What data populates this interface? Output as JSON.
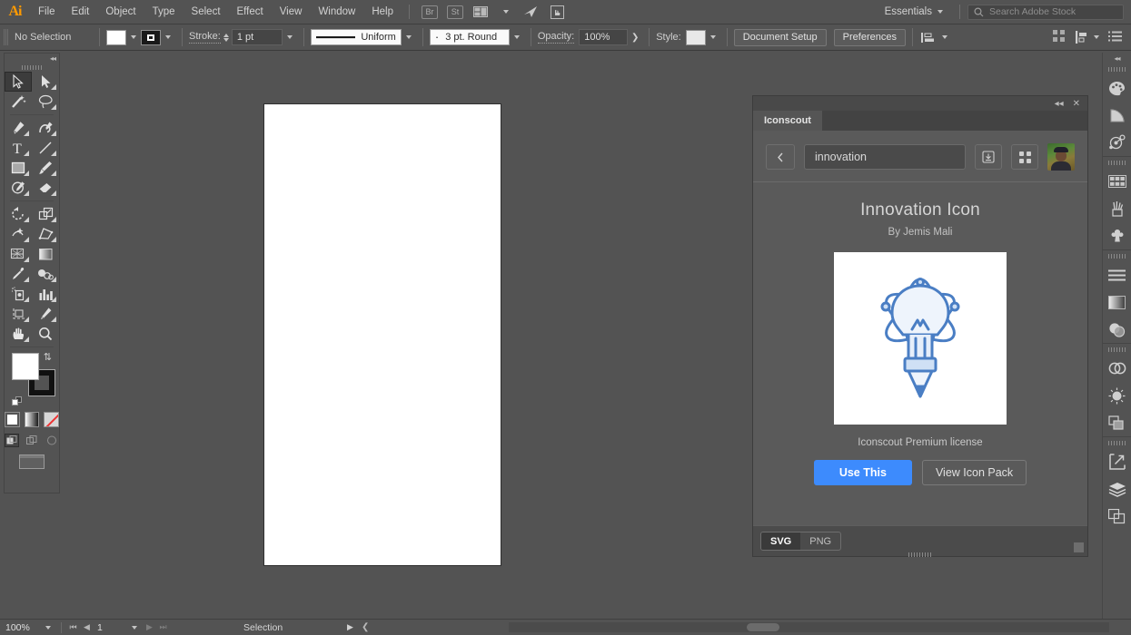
{
  "app": {
    "name": "Adobe Illustrator",
    "logo_text": "Ai"
  },
  "menubar": {
    "items": [
      {
        "label": "File"
      },
      {
        "label": "Edit"
      },
      {
        "label": "Object"
      },
      {
        "label": "Type"
      },
      {
        "label": "Select"
      },
      {
        "label": "Effect"
      },
      {
        "label": "View"
      },
      {
        "label": "Window"
      },
      {
        "label": "Help"
      }
    ],
    "icons": [
      {
        "name": "bridge-icon",
        "label": "Br"
      },
      {
        "name": "stock-icon",
        "label": "St"
      },
      {
        "name": "arrange-documents-icon",
        "label": ""
      },
      {
        "name": "behance-icon",
        "label": ""
      },
      {
        "name": "touch-workspace-icon",
        "label": ""
      }
    ],
    "workspace": "Essentials",
    "stock_search_placeholder": "Search Adobe Stock"
  },
  "controlbar": {
    "selection_status": "No Selection",
    "fill_label": "Fill",
    "stroke_label": "Stroke:",
    "stroke_weight": "1 pt",
    "stroke_profile": "Uniform",
    "brush_definition": "3 pt. Round",
    "opacity_label": "Opacity:",
    "opacity_value": "100%",
    "style_label": "Style:",
    "document_setup": "Document Setup",
    "preferences": "Preferences"
  },
  "toolbar": {
    "tools": [
      {
        "name": "selection-tool",
        "active": true
      },
      {
        "name": "direct-selection-tool",
        "active": false
      },
      {
        "name": "magic-wand-tool",
        "active": false
      },
      {
        "name": "lasso-tool",
        "active": false
      },
      {
        "name": "pen-tool",
        "active": false
      },
      {
        "name": "curvature-tool",
        "active": false
      },
      {
        "name": "type-tool",
        "active": false
      },
      {
        "name": "line-segment-tool",
        "active": false
      },
      {
        "name": "rectangle-tool",
        "active": false
      },
      {
        "name": "paintbrush-tool",
        "active": false
      },
      {
        "name": "shaper-tool",
        "active": false
      },
      {
        "name": "eraser-tool",
        "active": false
      },
      {
        "name": "rotate-tool",
        "active": false
      },
      {
        "name": "scale-tool",
        "active": false
      },
      {
        "name": "width-tool",
        "active": false
      },
      {
        "name": "free-transform-tool",
        "active": false
      },
      {
        "name": "shape-builder-tool",
        "active": false
      },
      {
        "name": "gradient-tool",
        "active": false
      },
      {
        "name": "eyedropper-tool",
        "active": false
      },
      {
        "name": "blend-tool",
        "active": false
      },
      {
        "name": "symbol-sprayer-tool",
        "active": false
      },
      {
        "name": "column-graph-tool",
        "active": false
      },
      {
        "name": "artboard-tool",
        "active": false
      },
      {
        "name": "slice-tool",
        "active": false
      },
      {
        "name": "hand-tool",
        "active": false
      },
      {
        "name": "zoom-tool",
        "active": false
      }
    ],
    "fill_color": "#ffffff",
    "stroke_color": "#111111"
  },
  "panel": {
    "tab_label": "Iconscout",
    "search_value": "innovation",
    "back_icon": "chevron-left-icon",
    "download_icon": "download-icon",
    "grid_icon": "grid-icon",
    "avatar_name": "user-avatar",
    "icon_title": "Innovation Icon",
    "author_prefix": "By",
    "author_name": "Jemis Mali",
    "license": "Iconscout Premium license",
    "use_this_label": "Use This",
    "view_pack_label": "View Icon Pack",
    "format_svg": "SVG",
    "format_png": "PNG",
    "accent_color": "#3d8bfd",
    "artwork_color": "#4a7ec4"
  },
  "dock": {
    "icons": [
      {
        "name": "color-panel-icon"
      },
      {
        "name": "color-guide-panel-icon"
      },
      {
        "name": "recolor-artwork-icon"
      },
      {
        "name": "swatches-panel-icon"
      },
      {
        "name": "brushes-panel-icon"
      },
      {
        "name": "symbols-panel-icon"
      },
      {
        "name": "paragraph-panel-icon"
      },
      {
        "name": "gradient-panel-icon"
      },
      {
        "name": "transparency-panel-icon"
      },
      {
        "name": "cc-libraries-icon"
      },
      {
        "name": "appearance-panel-icon"
      },
      {
        "name": "pathfinder-panel-icon"
      },
      {
        "name": "asset-export-icon"
      },
      {
        "name": "layers-panel-icon"
      },
      {
        "name": "artboards-panel-icon"
      }
    ]
  },
  "statusbar": {
    "zoom_level": "100%",
    "page_number": "1",
    "current_tool": "Selection"
  }
}
